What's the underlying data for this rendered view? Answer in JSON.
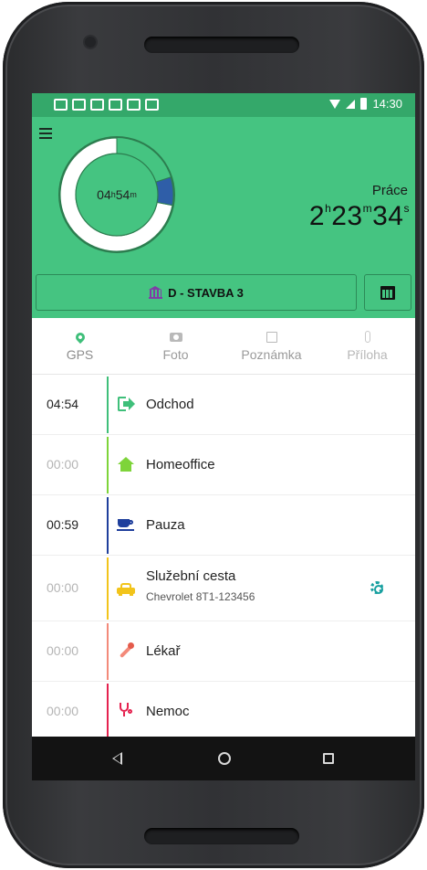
{
  "status_bar": {
    "time": "14:30",
    "notification_icons": [
      "gb-icon",
      "gmail-icon",
      "gmail-icon",
      "image-icon",
      "app-icon",
      "car-icon"
    ]
  },
  "header": {
    "donut_time_h": "04",
    "donut_unit_h": "h",
    "donut_time_m": "54",
    "donut_unit_m": "m",
    "work_label": "Práce",
    "work_h": "2",
    "work_unit_h": "h",
    "work_m": "23",
    "work_unit_m": "m",
    "work_s": "34",
    "work_unit_s": "s",
    "site_label": "D - STAVBA 3",
    "donut_segments": {
      "white_fraction": 0.72,
      "blue_fraction": 0.08
    },
    "colors": {
      "header_bg": "#45c481",
      "donut_white": "#ffffff",
      "donut_blue": "#2f5ea8",
      "donut_green": "#45c481"
    }
  },
  "tabs": [
    {
      "label": "GPS",
      "icon": "map-pin-icon"
    },
    {
      "label": "Foto",
      "icon": "camera-icon"
    },
    {
      "label": "Poznámka",
      "icon": "edit-icon"
    },
    {
      "label": "Příloha",
      "icon": "paperclip-icon"
    }
  ],
  "entries": [
    {
      "time": "04:54",
      "label": "Odchod",
      "sub": "",
      "color": "#3fbf7a",
      "icon": "exit-icon"
    },
    {
      "time": "00:00",
      "label": "Homeoffice",
      "sub": "",
      "color": "#7ed43a",
      "icon": "home-icon"
    },
    {
      "time": "00:59",
      "label": "Pauza",
      "sub": "",
      "color": "#1f3f9c",
      "icon": "coffee-icon"
    },
    {
      "time": "00:00",
      "label": "Služební cesta",
      "sub": "Chevrolet 8T1-123456",
      "color": "#f2c41b",
      "icon": "car-icon"
    },
    {
      "time": "00:00",
      "label": "Lékař",
      "sub": "",
      "color": "#f38a7a",
      "icon": "pipette-icon"
    },
    {
      "time": "00:00",
      "label": "Nemoc",
      "sub": "",
      "color": "#e5224f",
      "icon": "stethoscope-icon"
    }
  ]
}
